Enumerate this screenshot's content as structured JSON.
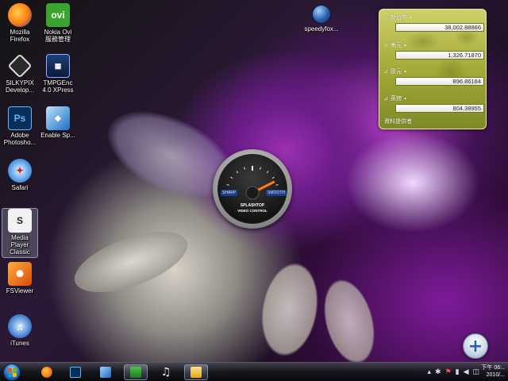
{
  "desktop": {
    "icons": [
      {
        "label": "Mozilla\nFirefox",
        "icon": "firefox-icon"
      },
      {
        "label": "Nokia Ovi\n服務管理",
        "icon": "ovi-icon"
      },
      {
        "label": "SILKYPIX\nDevelop...",
        "icon": "silkypix-icon"
      },
      {
        "label": "TMPGEnc\n4.0 XPress",
        "icon": "tmpgenc-icon"
      },
      {
        "label": "Adobe\nPhotosho...",
        "icon": "photoshop-icon"
      },
      {
        "label": "Enable Sp...",
        "icon": "enable-icon"
      },
      {
        "label": "Safari",
        "icon": "safari-icon"
      },
      {
        "label": "Media\nPlayer\nClassic",
        "icon": "media-player-icon"
      },
      {
        "label": "FSViewer",
        "icon": "fsviewer-icon"
      },
      {
        "label": "iTunes",
        "icon": "itunes-icon"
      },
      {
        "label": "speedyfox...",
        "icon": "speedyfox-icon"
      }
    ]
  },
  "currency_gadget": {
    "rows": [
      {
        "label": "新台幣",
        "value": "38,002.88866"
      },
      {
        "label": "美元",
        "value": "1,326.71870"
      },
      {
        "label": "歐元",
        "value": "896.86184"
      },
      {
        "label": "英鎊",
        "value": "804.38955"
      }
    ],
    "footer": "資料提供者"
  },
  "gauge_gadget": {
    "left_label": "SHARP",
    "right_label": "SMOOTH",
    "brand": "SPLASHTOP",
    "subtitle": "VIDEO CONTROL",
    "level": 0.85
  },
  "taskbar": {
    "apps": [
      "firefox-icon",
      "photoshop-icon",
      "windows-explorer-icon",
      "media-player-icon",
      "music-icon",
      "folder-icon"
    ],
    "clock_time": "下午 06:..",
    "clock_date": "2010/..."
  }
}
